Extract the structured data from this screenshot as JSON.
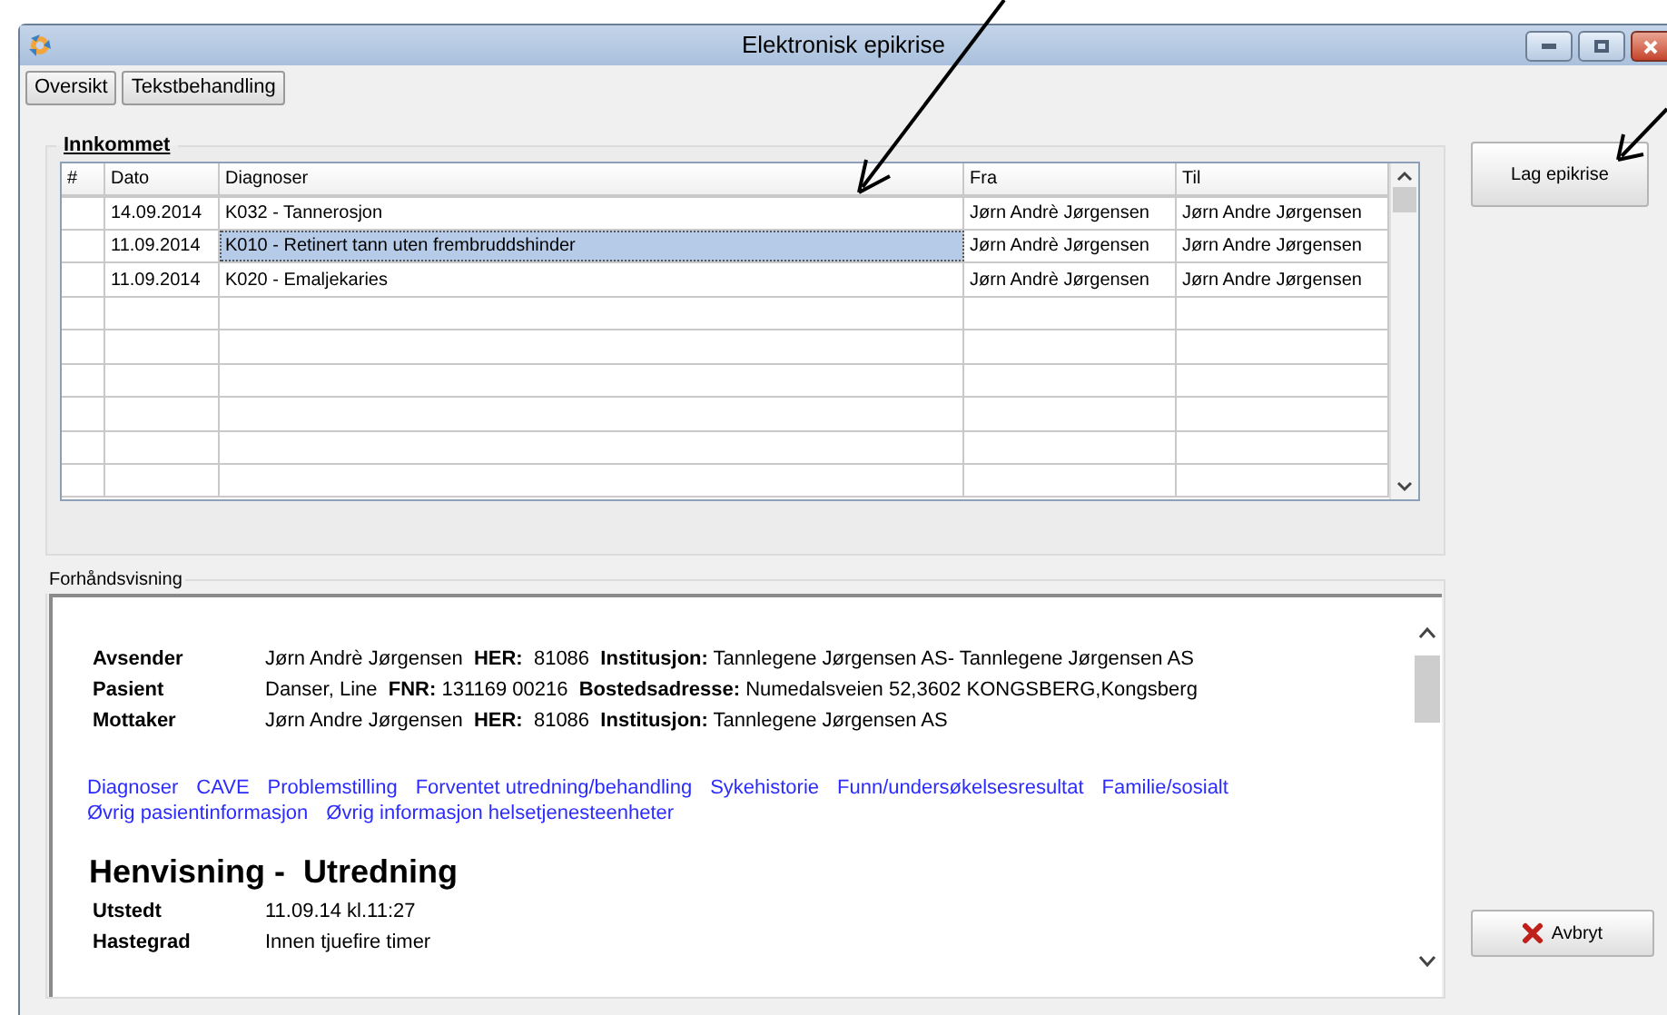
{
  "window": {
    "title": "Elektronisk epikrise"
  },
  "toolbar_buttons": [
    "Oversikt",
    "Tekstbehandling"
  ],
  "incoming": {
    "title": "Innkommet",
    "columns": [
      "#",
      "Dato",
      "Diagnoser",
      "Fra",
      "Til"
    ],
    "rows": [
      {
        "cells": [
          "",
          "14.09.2014",
          "K032 - Tannerosjon",
          "Jørn Andrè Jørgensen",
          "Jørn Andre Jørgensen"
        ],
        "selected": false
      },
      {
        "cells": [
          "",
          "11.09.2014",
          "K010 - Retinert tann uten frembruddshinder",
          "Jørn Andrè Jørgensen",
          "Jørn Andre Jørgensen"
        ],
        "selected": true
      },
      {
        "cells": [
          "",
          "11.09.2014",
          "K020 - Emaljekaries",
          "Jørn Andrè Jørgensen",
          "Jørn Andre Jørgensen"
        ],
        "selected": false
      }
    ]
  },
  "create_button": "Lag epikrise",
  "preview": {
    "title": "Forhåndsvisning",
    "parties": [
      {
        "label": "Avsender",
        "text": "Jørn Andrè Jørgensen  **HER:**  81086  **Institusjon:** Tannlegene Jørgensen AS- Tannlegene Jørgensen AS"
      },
      {
        "label": "Pasient",
        "text": "Danser, Line  **FNR:** 131169 00216  **Bostedsadresse:** Numedalsveien 52,3602 KONGSBERG,Kongsberg"
      },
      {
        "label": "Mottaker",
        "text": "Jørn Andre Jørgensen  **HER:**  81086  **Institusjon:** Tannlegene Jørgensen AS"
      }
    ],
    "links": [
      "Diagnoser",
      "CAVE",
      "Problemstilling",
      "Forventet utredning/behandling",
      "Sykehistorie",
      "Funn/undersøkelsesresultat",
      "Familie/sosialt",
      "Øvrig pasientinformasjon",
      "Øvrig informasjon helsetjenesteenheter"
    ],
    "heading": "Henvisning -  Utredning",
    "details": [
      {
        "label": "Utstedt",
        "value": "11.09.14 kl.11:27"
      },
      {
        "label": "Hastegrad",
        "value": "Innen tjuefire timer"
      }
    ]
  },
  "cancel_button": "Avbryt"
}
